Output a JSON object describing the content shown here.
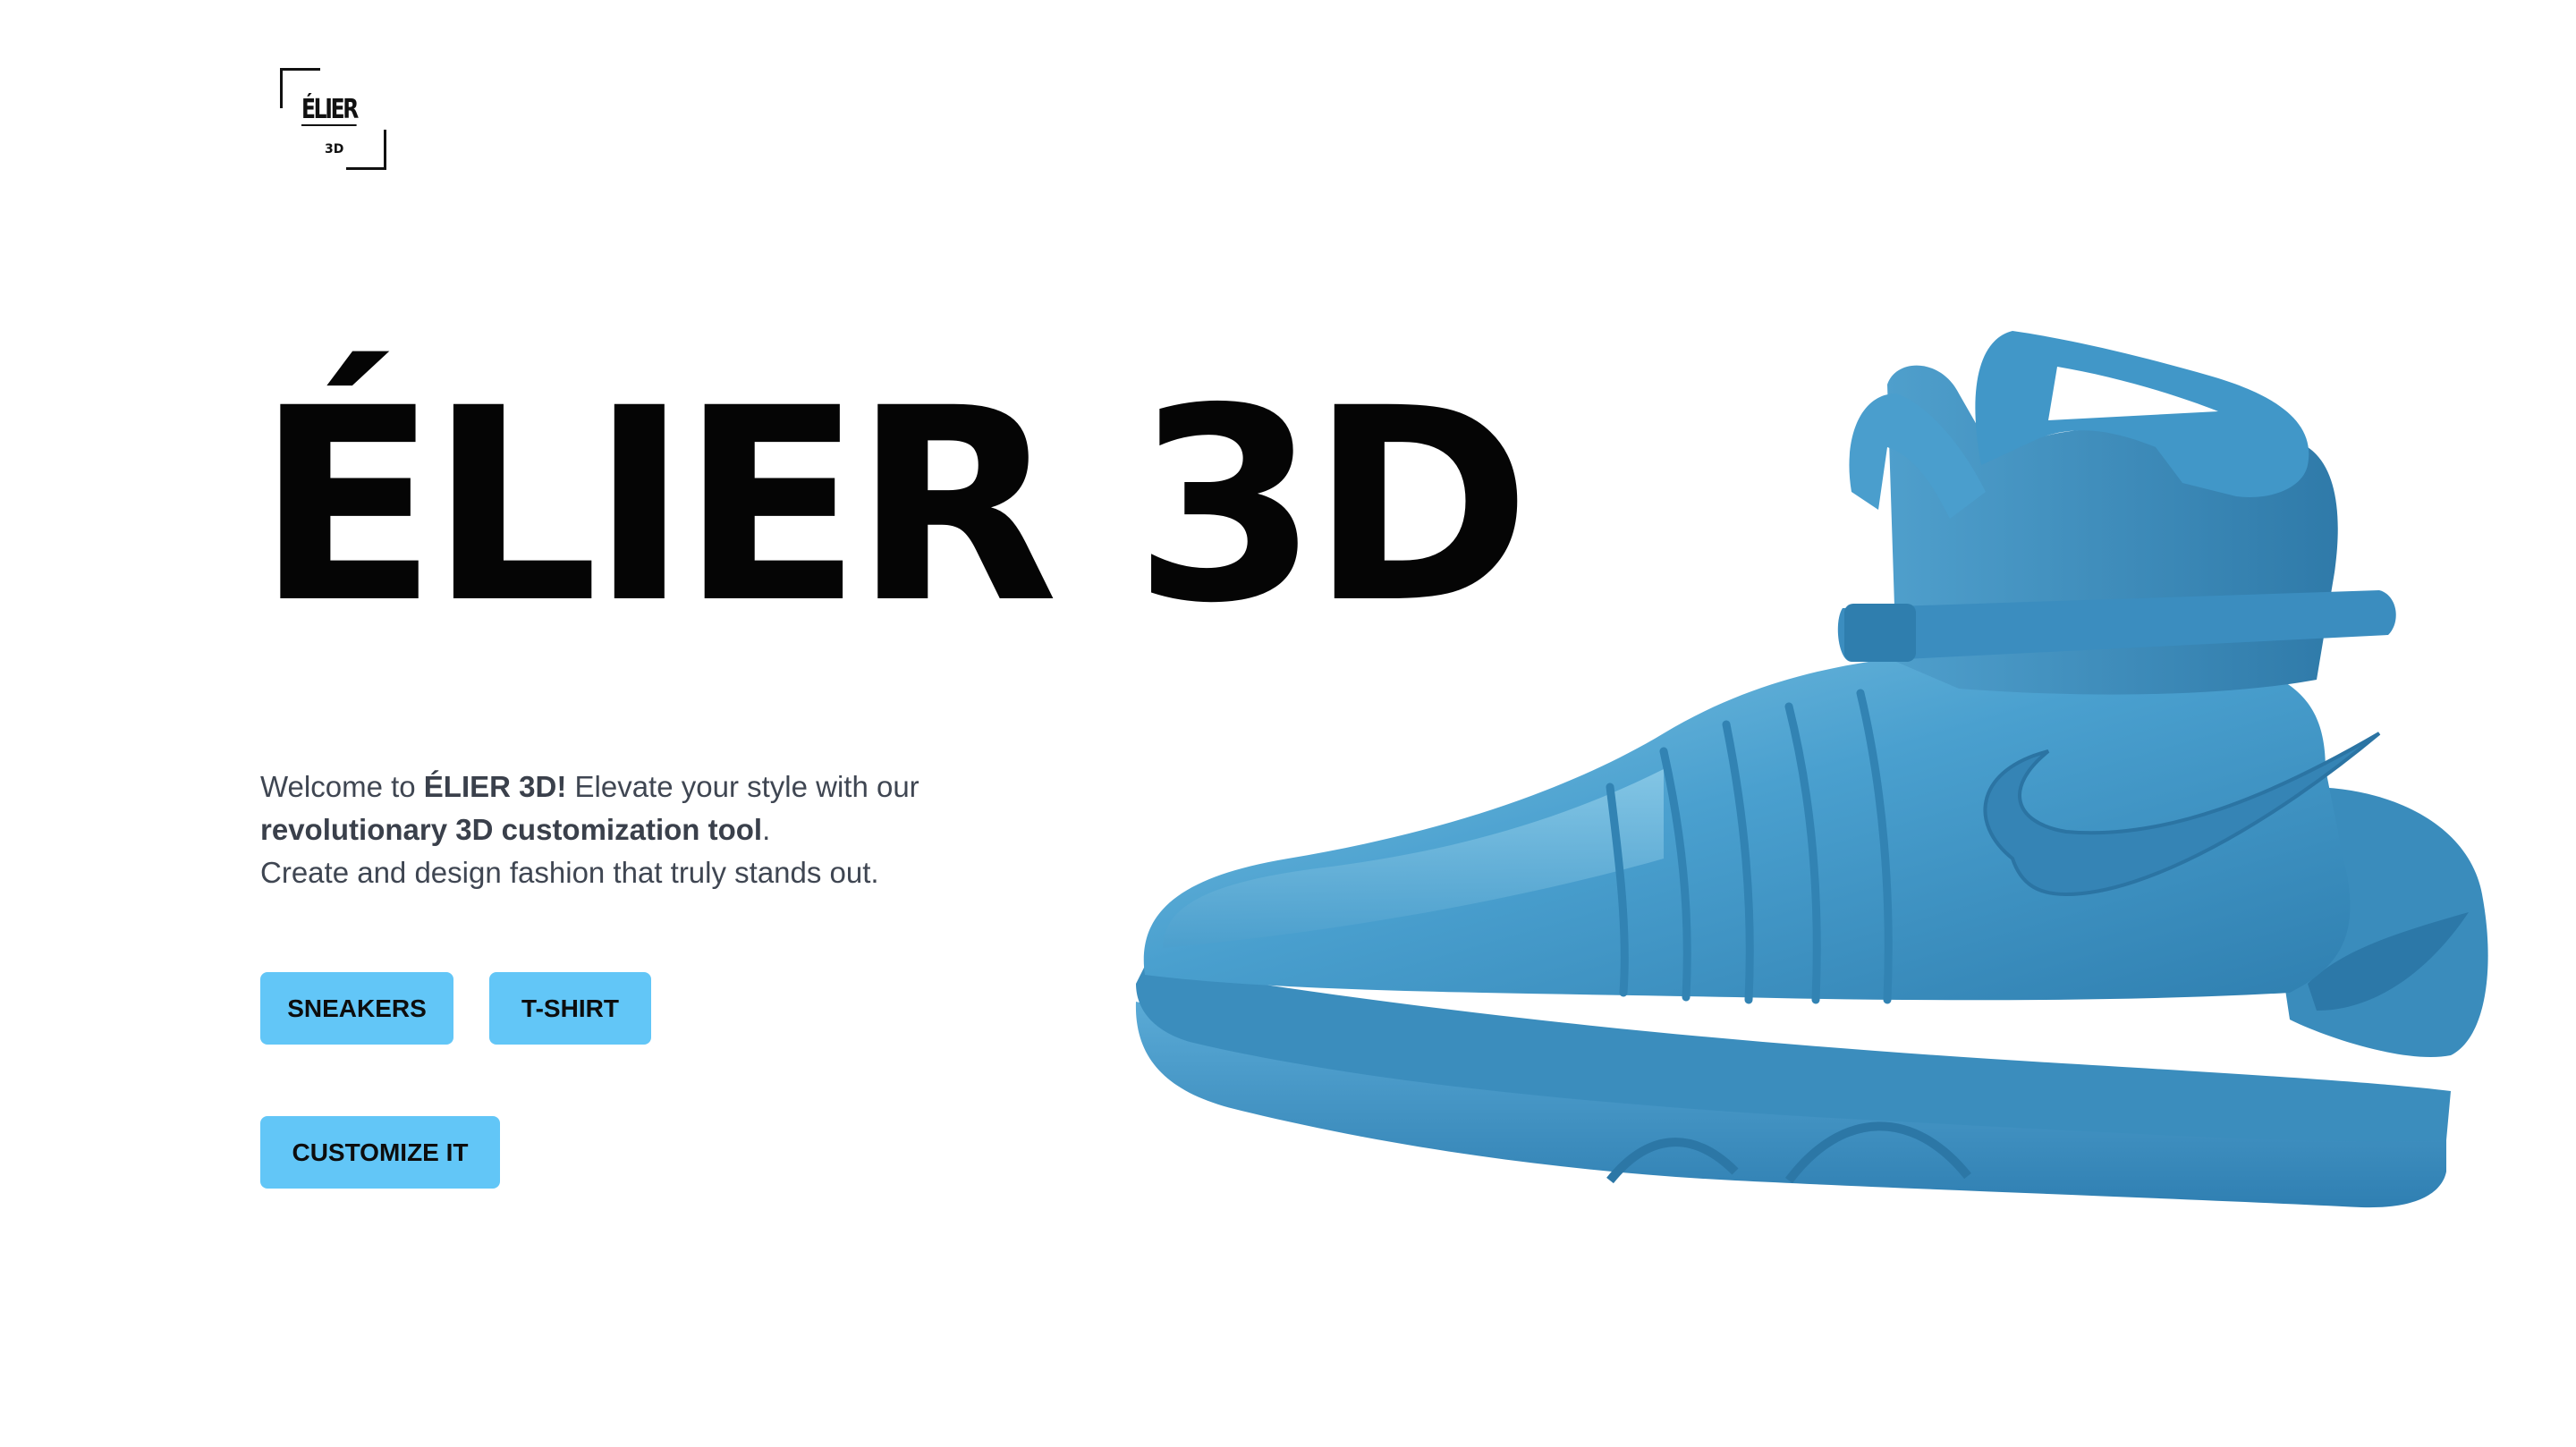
{
  "logo": {
    "word": "ÉLIER",
    "sub": "3D"
  },
  "hero": {
    "title": "ÉLIER 3D"
  },
  "intro": {
    "line1_prefix": "Welcome to ",
    "line1_bold": "ÉLIER 3D!",
    "line1_suffix": " Elevate your style with our",
    "line2_bold": "revolutionary 3D customization tool",
    "line2_suffix": ".",
    "line3": "Create and design fashion that truly stands out."
  },
  "buttons": {
    "sneakers": "SNEAKERS",
    "tshirt": "T-SHIRT",
    "customize": "CUSTOMIZE IT"
  },
  "model": {
    "icon": "sneaker-3d-model",
    "color": "#3d8fbd"
  },
  "colors": {
    "accent": "#62c6f7",
    "text": "#3f4652",
    "title": "#050505"
  }
}
